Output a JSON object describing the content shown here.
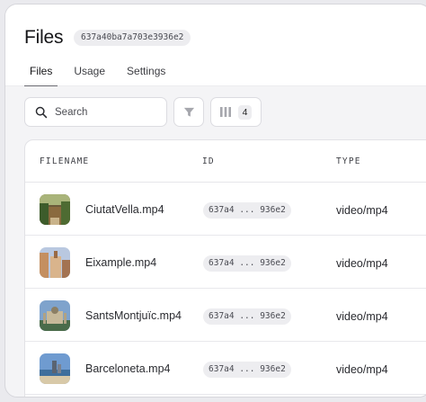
{
  "header": {
    "title": "Files",
    "id_chip": "637a40ba7a703e3936e2"
  },
  "tabs": [
    {
      "label": "Files"
    },
    {
      "label": "Usage"
    },
    {
      "label": "Settings"
    }
  ],
  "toolbar": {
    "search_placeholder": "Search",
    "columns_count": "4"
  },
  "table": {
    "columns": [
      "FILENAME",
      "ID",
      "TYPE"
    ],
    "rows": [
      {
        "filename": "CiutatVella.mp4",
        "id": "637a4 ... 936e2",
        "type": "video/mp4"
      },
      {
        "filename": "Eixample.mp4",
        "id": "637a4 ... 936e2",
        "type": "video/mp4"
      },
      {
        "filename": "SantsMontjuïc.mp4",
        "id": "637a4 ... 936e2",
        "type": "video/mp4"
      },
      {
        "filename": "Barceloneta.mp4",
        "id": "637a4 ... 936e2",
        "type": "video/mp4"
      }
    ]
  }
}
